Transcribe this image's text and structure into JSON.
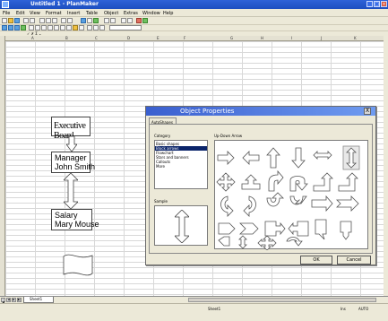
{
  "window": {
    "title": "Untitled 1 - PlanMaker"
  },
  "menu": [
    "File",
    "Edit",
    "View",
    "Format",
    "Insert",
    "Table",
    "Object",
    "Extras",
    "Window",
    "Help"
  ],
  "columns": [
    "A",
    "B",
    "C",
    "D",
    "E",
    "F",
    "G",
    "H",
    "I",
    "J",
    "K"
  ],
  "sheet": {
    "box1": "Executive Board",
    "box2_line1": "Manager",
    "box2_line2": "John Smith",
    "box3_line1": "Salary",
    "box3_line2": "Mary Mouse"
  },
  "dialog": {
    "title": "Object Properties",
    "close": "X",
    "tab": "AutoShapes",
    "category_label": "Category",
    "categories": [
      "Basic shapes",
      "Block arrows",
      "Flowchart",
      "Stars and banners",
      "Callouts",
      "More"
    ],
    "selected_category_index": 1,
    "shape_group_label": "Up-Down Arrow",
    "sample_label": "Sample",
    "ok": "OK",
    "cancel": "Cancel"
  },
  "sheet_tabs": {
    "tab1": "Sheet1"
  },
  "status": {
    "sheet": "Sheet1",
    "mode": "Ins",
    "auto": "AUTO"
  }
}
